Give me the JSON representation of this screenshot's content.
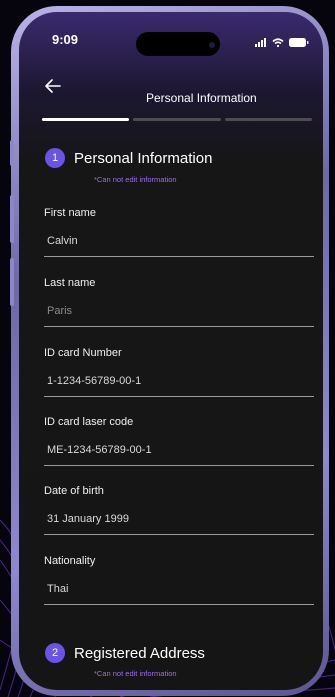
{
  "status": {
    "time": "9:09"
  },
  "header": {
    "title": "Personal Information",
    "steps": 3,
    "active_step": 1
  },
  "section1": {
    "number": "1",
    "title": "Personal Information",
    "note": "*Can not edit information"
  },
  "fields": [
    {
      "label": "First name",
      "value": "Calvin"
    },
    {
      "label": "Last name",
      "value": "Paris"
    },
    {
      "label": "ID card Number",
      "value": "1-1234-56789-00-1"
    },
    {
      "label": "ID card laser code",
      "value": "ME-1234-56789-00-1"
    },
    {
      "label": "Date of birth",
      "value": "31 January 1999"
    },
    {
      "label": "Nationality",
      "value": "Thai"
    }
  ],
  "section2": {
    "number": "2",
    "title": "Registered Address",
    "note": "*Can not edit information"
  },
  "colors": {
    "accent": "#6a54e6",
    "note": "#9d6cf4",
    "background": "#151515"
  },
  "icons": {
    "back": "arrow-left-icon",
    "signal": "signal-icon",
    "wifi": "wifi-icon",
    "battery": "battery-icon"
  }
}
